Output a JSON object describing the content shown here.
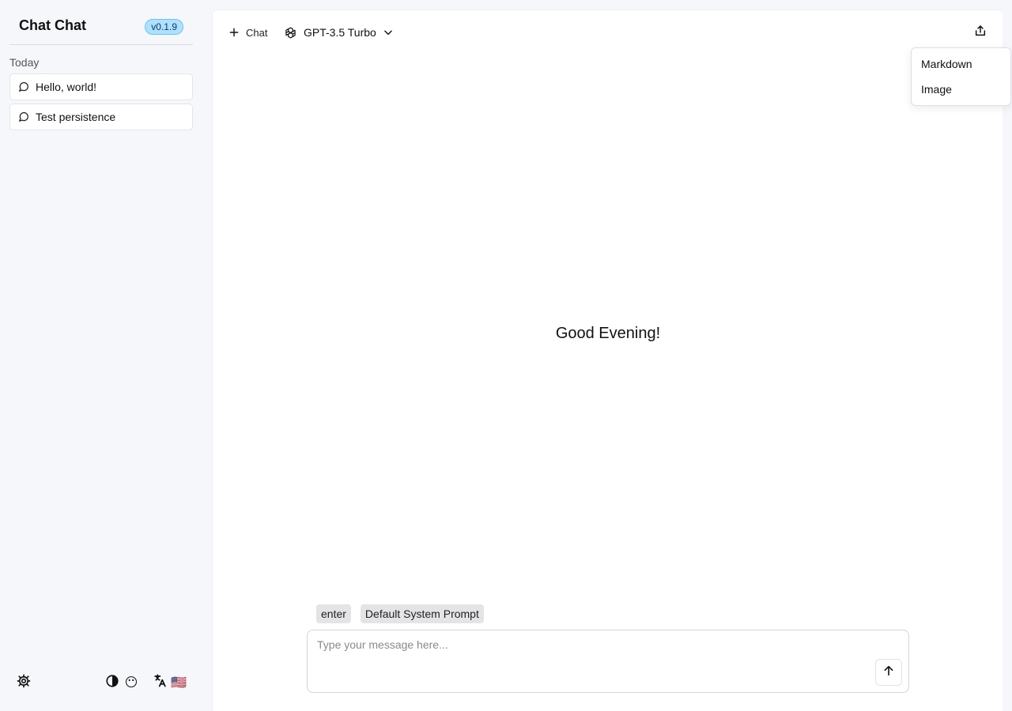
{
  "sidebar": {
    "app_title": "Chat Chat",
    "version": "v0.1.9",
    "section_label": "Today",
    "conversations": [
      {
        "label": "Hello, world!",
        "icon": "message-circle-icon"
      },
      {
        "label": "Test persistence",
        "icon": "message-circle-icon"
      }
    ],
    "footer": {
      "settings_icon": "gear-icon",
      "theme_icon": "contrast-icon",
      "emoji": "😶",
      "language_icon": "translate-icon",
      "flag": "🇺🇸"
    }
  },
  "toolbar": {
    "new_chat_label": "Chat",
    "model_label": "GPT-3.5 Turbo",
    "model_icon": "openai-logo-icon",
    "share_icon": "share-icon"
  },
  "main": {
    "greeting": "Good Evening!",
    "chips": [
      "enter",
      "Default System Prompt"
    ],
    "input_placeholder": "Type your message here...",
    "send_icon": "arrow-up-icon"
  },
  "share_menu": {
    "items": [
      "Markdown",
      "Image"
    ]
  },
  "colors": {
    "badge_bg": "#aee0ff",
    "badge_border": "#6cc3f5",
    "page_bg": "#f6f7fb"
  }
}
